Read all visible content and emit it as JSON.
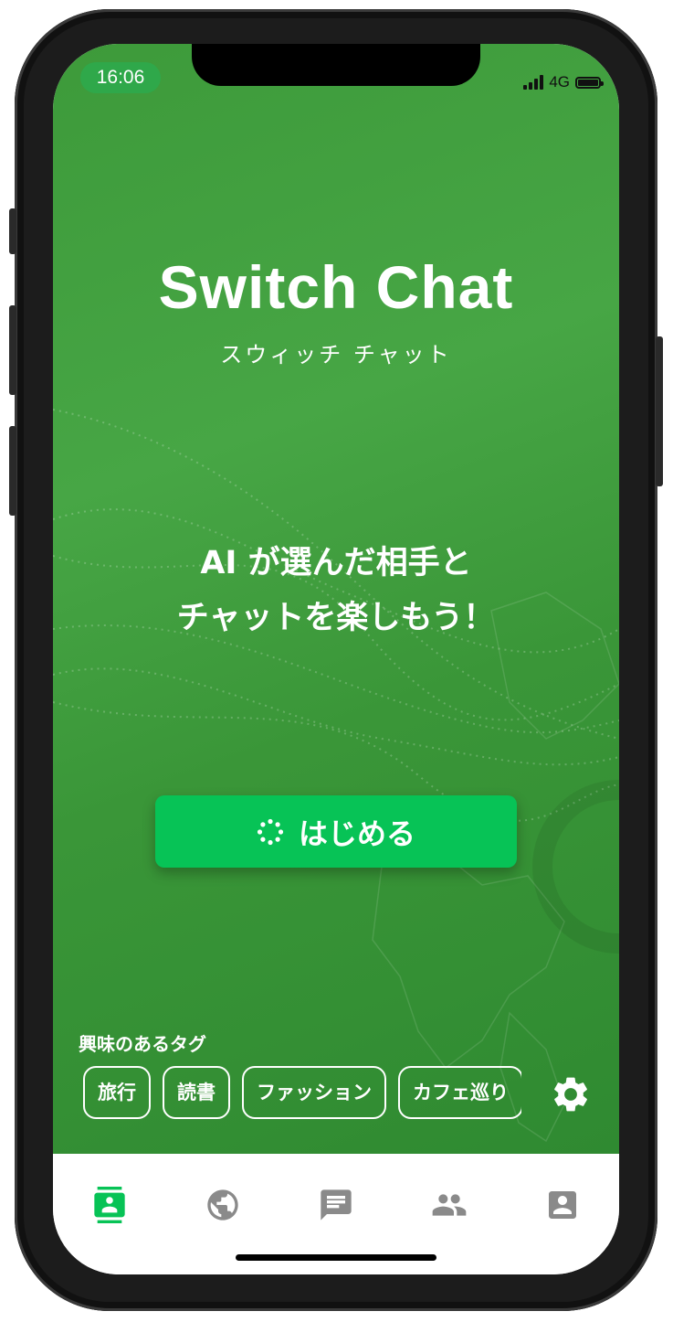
{
  "status_bar": {
    "time": "16:06",
    "network": "4G"
  },
  "app": {
    "title": "Switch Chat",
    "subtitle": "スウィッチ チャット"
  },
  "hero": {
    "tagline_line1": "AI が選んだ相手と",
    "tagline_line2": "チャットを楽しもう！"
  },
  "start_button": {
    "label": "はじめる",
    "icon": "sparkle-loader-icon"
  },
  "tags": {
    "label": "興味のあるタグ",
    "items": [
      "旅行",
      "読書",
      "ファッション",
      "カフェ巡り"
    ]
  },
  "settings": {
    "icon": "gear-icon"
  },
  "tabbar": {
    "items": [
      {
        "icon": "contact-book-icon",
        "active": true
      },
      {
        "icon": "globe-icon",
        "active": false
      },
      {
        "icon": "chat-bubble-icon",
        "active": false
      },
      {
        "icon": "people-icon",
        "active": false
      },
      {
        "icon": "profile-icon",
        "active": false
      }
    ]
  },
  "colors": {
    "hero_green": "#47a645",
    "button_green": "#07c356",
    "active_tab": "#07c356",
    "inactive_tab": "#8a8a8a"
  }
}
